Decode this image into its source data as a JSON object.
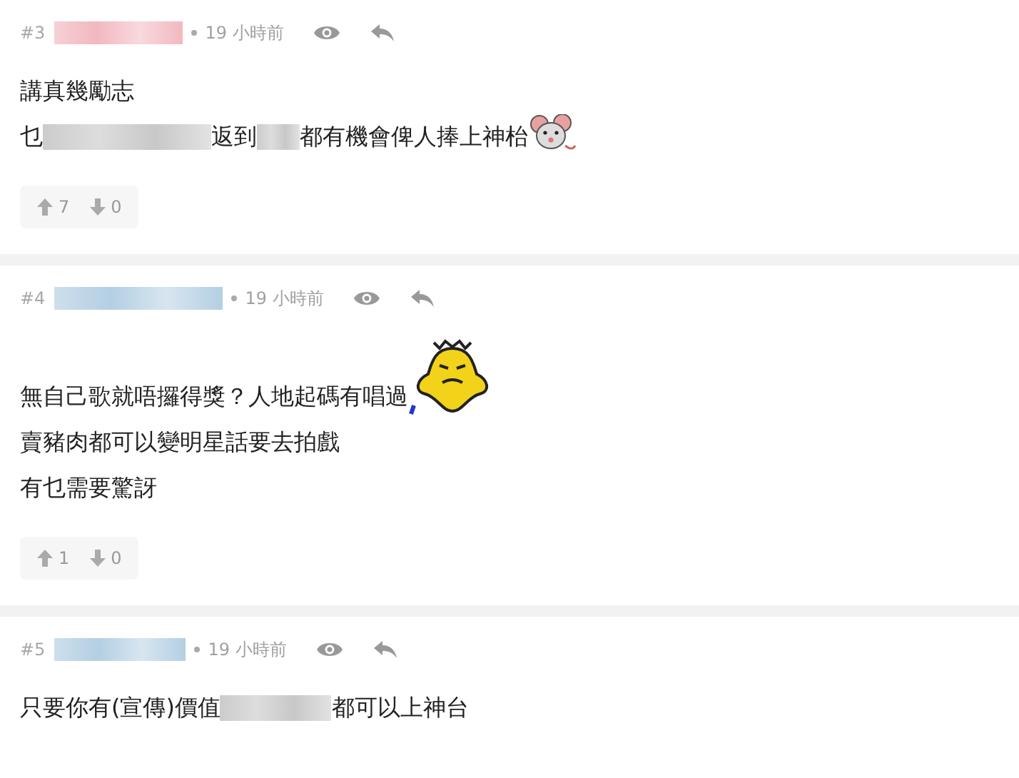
{
  "posts": [
    {
      "number": "#3",
      "color": "#f2b8c0",
      "time": "19 小時前",
      "lines": [
        {
          "segments": [
            {
              "kind": "text",
              "text": "講真幾勵志"
            }
          ]
        },
        {
          "segments": [
            {
              "kind": "text",
              "text": "乜"
            },
            {
              "kind": "blur"
            },
            {
              "kind": "text",
              "text": "返到"
            },
            {
              "kind": "blur"
            },
            {
              "kind": "text",
              "text": "都有機會俾人捧上神枱"
            },
            {
              "kind": "mouse"
            }
          ]
        }
      ],
      "votes": {
        "up": "7",
        "down": "0"
      }
    },
    {
      "number": "#4",
      "color": "#b4cfe3",
      "time": "19 小時前",
      "lines": [
        {
          "segments": [
            {
              "kind": "text",
              "text": "無自己歌就唔攞得獎？人地起碼有唱過"
            },
            {
              "kind": "blob"
            }
          ]
        },
        {
          "segments": [
            {
              "kind": "text",
              "text": "賣豬肉都可以變明星話要去拍戲"
            }
          ]
        },
        {
          "segments": [
            {
              "kind": "text",
              "text": "有乜需要驚訝"
            }
          ]
        }
      ],
      "votes": {
        "up": "1",
        "down": "0"
      }
    },
    {
      "number": "#5",
      "color": "#b4cfe3",
      "time": "19 小時前",
      "lines": [
        {
          "segments": [
            {
              "kind": "text",
              "text": "只要你有(宣傳)價值"
            },
            {
              "kind": "blur"
            },
            {
              "kind": "text",
              "text": "都可以上神台"
            }
          ]
        }
      ]
    }
  ]
}
